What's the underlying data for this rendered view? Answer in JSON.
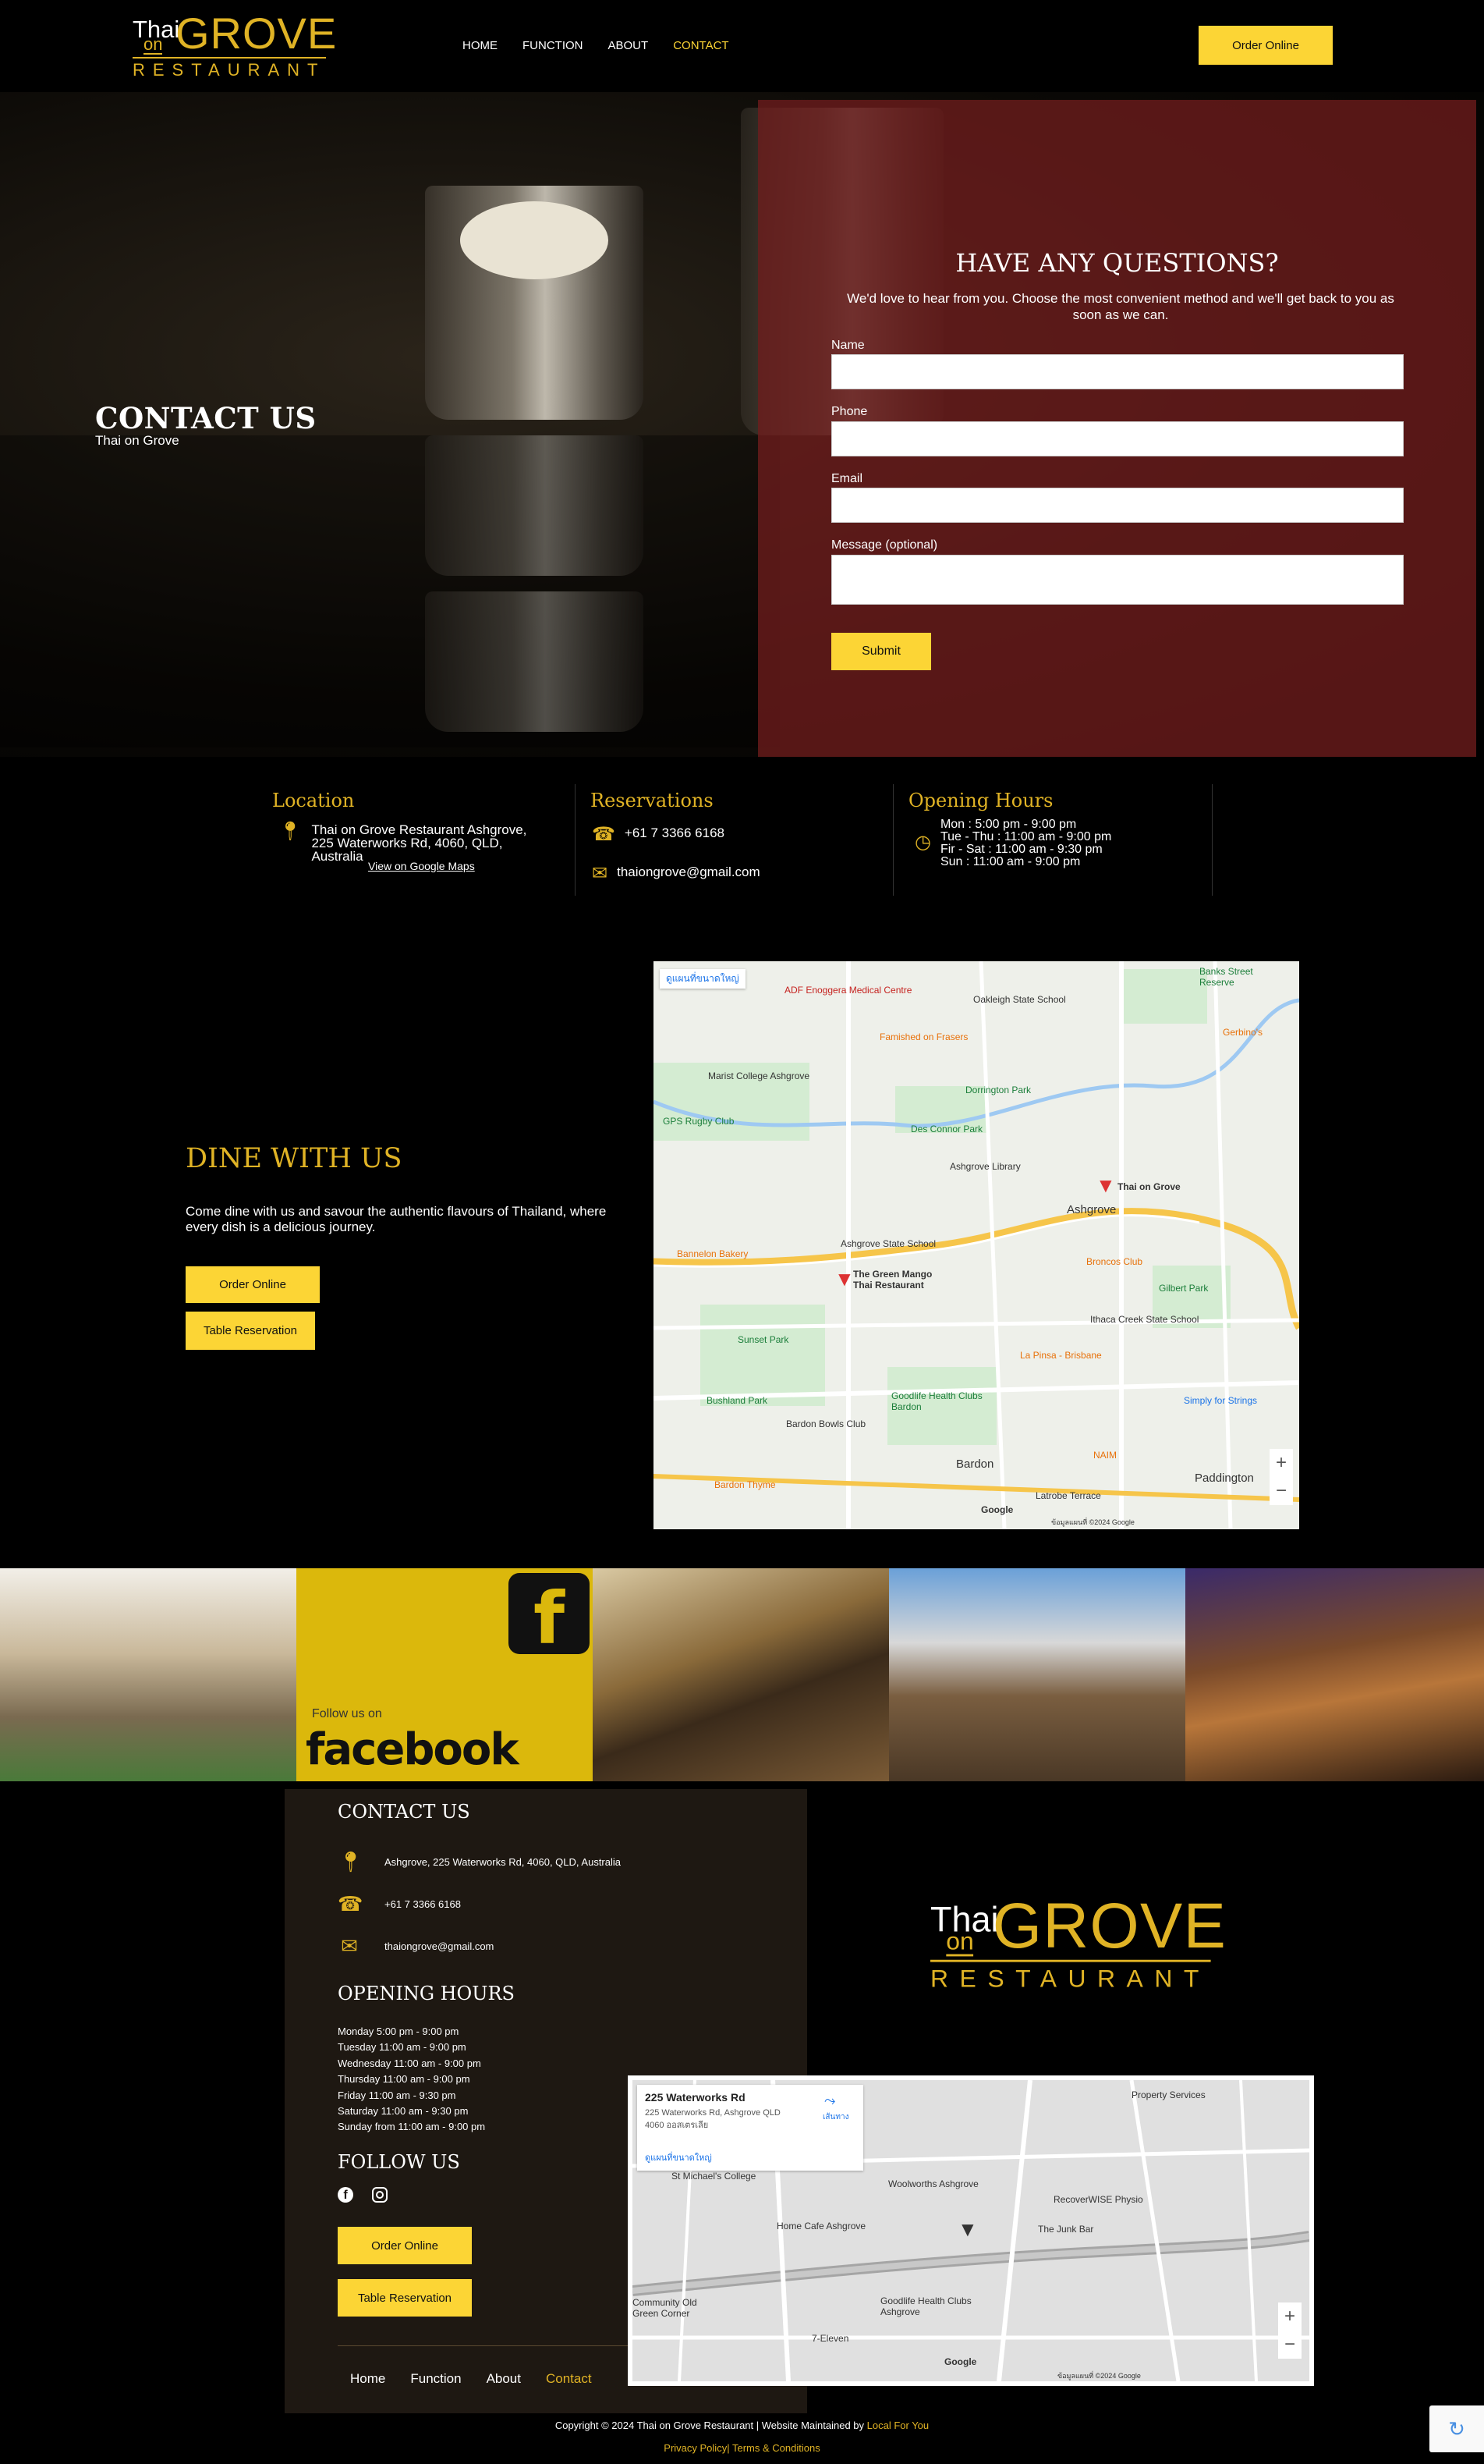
{
  "header": {
    "logo": {
      "thai": "Thai",
      "on": "on",
      "grove": "GROVE",
      "restaurant": "RESTAURANT"
    },
    "nav": [
      {
        "label": "HOME",
        "active": false
      },
      {
        "label": "FUNCTION",
        "active": false
      },
      {
        "label": "ABOUT",
        "active": false
      },
      {
        "label": "CONTACT",
        "active": true
      }
    ],
    "order_button": "Order Online"
  },
  "hero": {
    "title": "CONTACT US",
    "subtitle": "Thai on Grove"
  },
  "contact_form": {
    "heading": "HAVE ANY QUESTIONS?",
    "intro": "We'd love to hear from you. Choose the most convenient method and we'll get back to you as soon as we can.",
    "fields": {
      "name": "Name",
      "phone": "Phone",
      "email": "Email",
      "message": "Message (optional)"
    },
    "submit": "Submit"
  },
  "info": {
    "location": {
      "heading": "Location",
      "address": "Thai on Grove Restaurant Ashgrove, 225 Waterworks Rd, 4060, QLD, Australia",
      "maps_link": "View on Google Maps"
    },
    "reservations": {
      "heading": "Reservations",
      "phone": "+61 7 3366 6168",
      "email": "thaiongrove@gmail.com"
    },
    "hours": {
      "heading": "Opening Hours",
      "lines": [
        "Mon : 5:00 pm - 9:00 pm",
        "Tue - Thu : 11:00 am - 9:00 pm",
        "Fir - Sat : 11:00 am - 9:30 pm",
        "Sun : 11:00 am - 9:00 pm"
      ]
    }
  },
  "dine": {
    "title": "DINE WITH US",
    "text": "Come dine with us and savour the authentic flavours of Thailand, where every dish is a delicious journey.",
    "order_button": "Order Online",
    "table_button": "Table Reservation"
  },
  "map1": {
    "larger_map": "ดูแผนที่ขนาดใหญ่",
    "labels": {
      "oakleigh": "Oakleigh State School",
      "banks": "Banks Street Reserve",
      "adf": "ADF Enoggera Medical Centre",
      "famished": "Famished on Frasers",
      "marist": "Marist College Ashgrove",
      "dorrington": "Dorrington Park",
      "gps": "GPS Rugby Club",
      "desconnor": "Des Connor Park",
      "library": "Ashgrove Library",
      "thaiongrove": "Thai on Grove",
      "ashgrove": "Ashgrove",
      "bannelon": "Bannelon Bakery",
      "ashgrove_ss": "Ashgrove State School",
      "greenmango": "The Green Mango Thai Restaurant",
      "broncos": "Broncos Club",
      "gilbert": "Gilbert Park",
      "sunset": "Sunset Park",
      "ithaca": "Ithaca Creek State School",
      "lapinsa": "La Pinsa - Brisbane",
      "bushland": "Bushland Park",
      "goodlife": "Goodlife Health Clubs Bardon",
      "bowls": "Bardon Bowls Club",
      "simply": "Simply for Strings",
      "naim": "NAIM",
      "bardon": "Bardon",
      "paddington": "Paddington",
      "bardonthyme": "Bardon Thyme",
      "latrobe": "Latrobe Terrace",
      "gerbinos": "Gerbino's",
      "google": "Google",
      "attribution": "ข้อมูลแผนที่ ©2024 Google"
    }
  },
  "social_tile": {
    "follow": "Follow us on",
    "brand": "facebook"
  },
  "footer": {
    "contact_heading": "CONTACT US",
    "address": "Ashgrove, 225 Waterworks Rd, 4060, QLD, Australia",
    "phone": "+61 7 3366 6168",
    "email": "thaiongrove@gmail.com",
    "hours_heading": "OPENING HOURS",
    "hours": [
      "Monday 5:00 pm - 9:00 pm",
      "Tuesday 11:00 am - 9:00 pm",
      "Wednesday 11:00 am - 9:00 pm",
      "Thursday 11:00 am - 9:00 pm",
      "Friday 11:00 am - 9:30 pm",
      "Saturday 11:00 am - 9:30 pm",
      "Sunday from 11:00 am - 9:00 pm"
    ],
    "follow_heading": "FOLLOW US",
    "order_button": "Order Online",
    "table_button": "Table Reservation",
    "nav": [
      {
        "label": "Home",
        "active": false
      },
      {
        "label": "Function",
        "active": false
      },
      {
        "label": "About",
        "active": false
      },
      {
        "label": "Contact",
        "active": true
      }
    ]
  },
  "map2": {
    "card_title": "225 Waterworks Rd",
    "card_address": "225 Waterworks Rd, Ashgrove QLD 4060 ออสเตรเลีย",
    "card_directions": "เส้นทาง",
    "card_larger": "ดูแผนที่ขนาดใหญ่",
    "labels": {
      "property": "Property Services",
      "woolworths": "Woolworths Ashgrove",
      "recoverwise": "RecoverWISE Physio",
      "junkbar": "The Junk Bar",
      "homecafe": "Home Cafe Ashgrove",
      "goodlife": "Goodlife Health Clubs Ashgrove",
      "seven": "7-Eleven",
      "community": "Community Old Green Corner",
      "stmichael": "St Michael's College",
      "google": "Google",
      "attribution": "ข้อมูลแผนที่ ©2024 Google"
    }
  },
  "bottom": {
    "copyright": "Copyright © 2024 Thai on Grove Restaurant | Website Maintained by ",
    "maintainer": "Local For You",
    "privacy": "Privacy Policy",
    "separator": "|",
    "terms": "Terms & Conditions"
  }
}
